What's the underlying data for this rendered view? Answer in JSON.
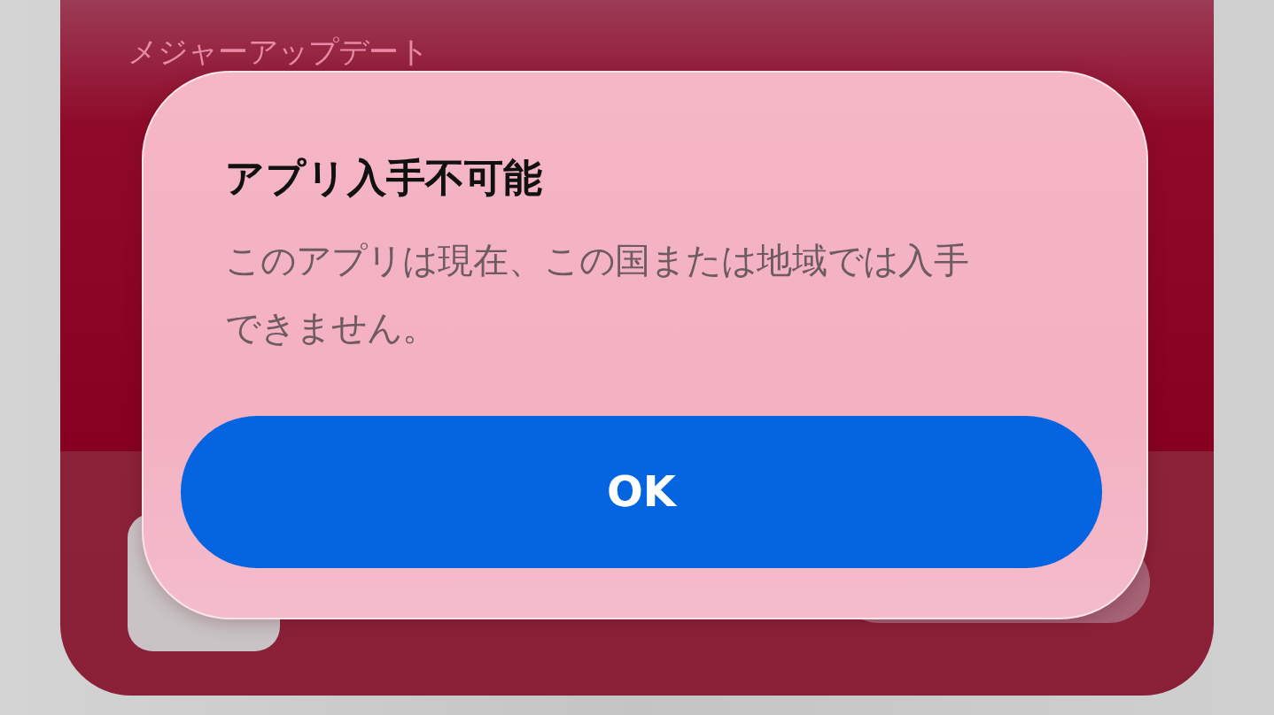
{
  "card": {
    "eyebrow": "メジャーアップデート"
  },
  "alert": {
    "title": "アプリ入手不可能",
    "message": "このアプリは現在、この国または地域では入手できません。",
    "buttons": [
      "OK"
    ]
  }
}
